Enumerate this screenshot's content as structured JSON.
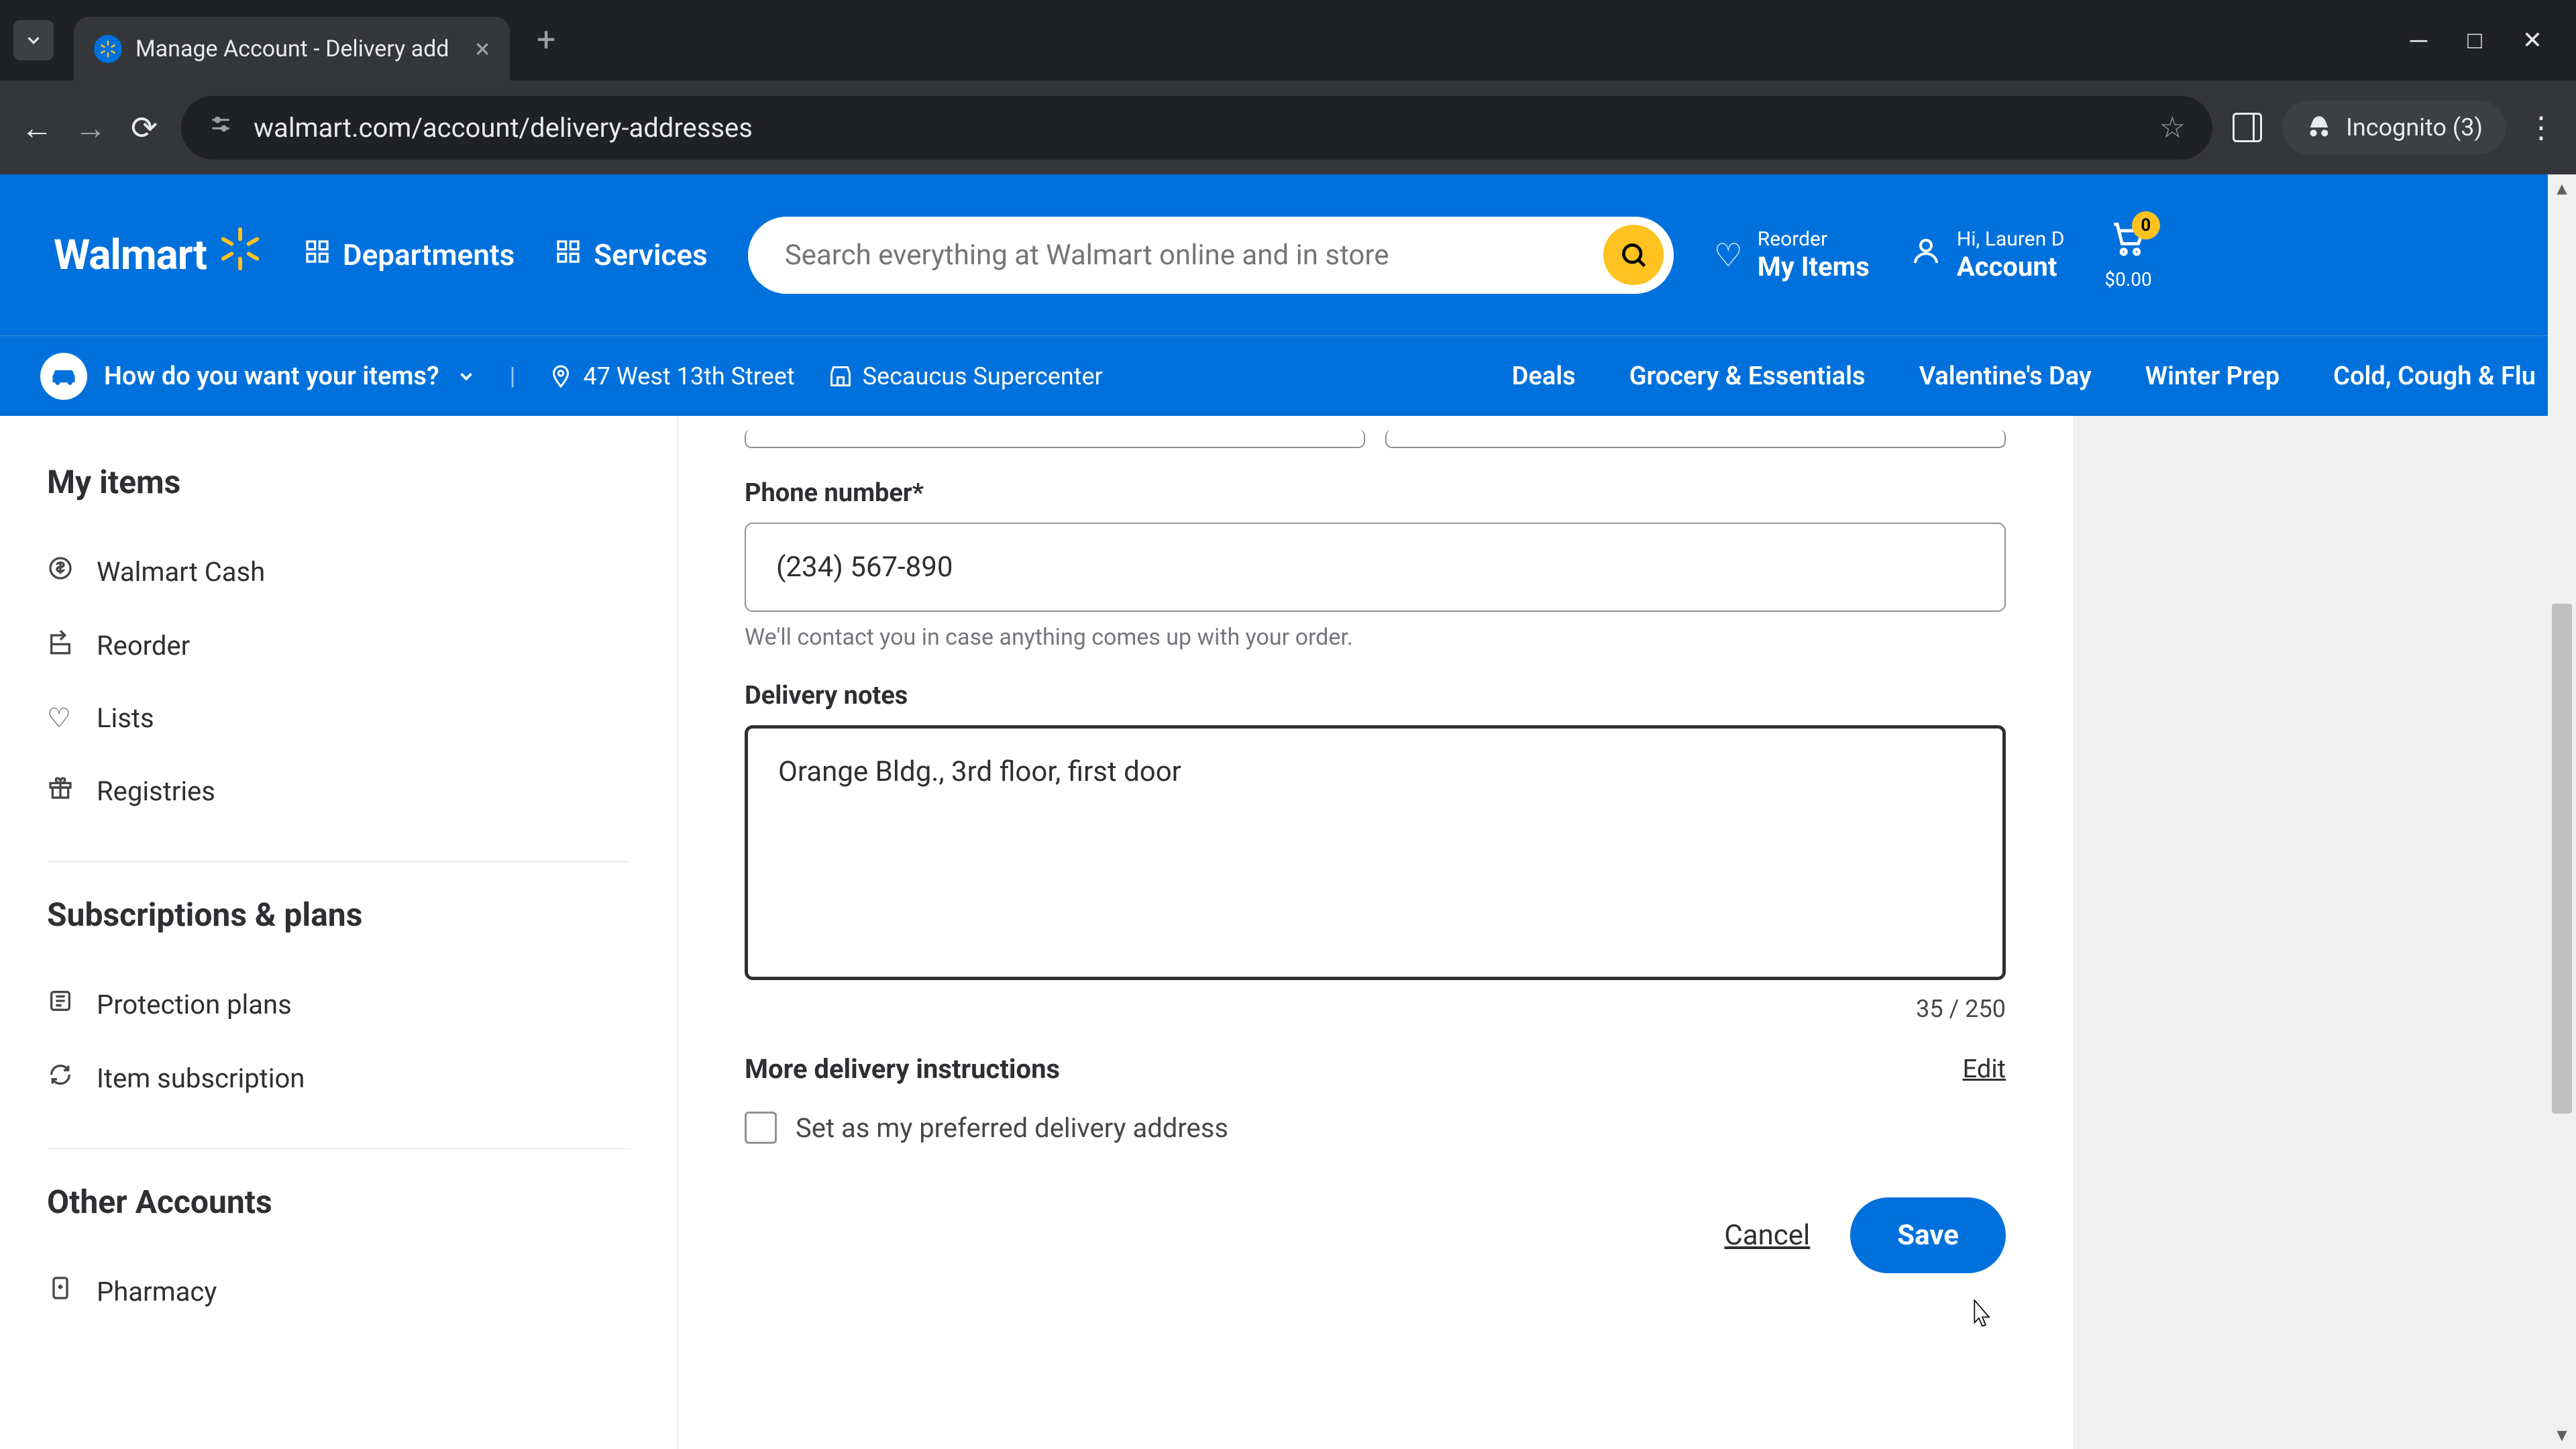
{
  "browser": {
    "tab_title": "Manage Account - Delivery add",
    "url": "walmart.com/account/delivery-addresses",
    "incognito_label": "Incognito (3)"
  },
  "header": {
    "logo_text": "Walmart",
    "departments": "Departments",
    "services": "Services",
    "search_placeholder": "Search everything at Walmart online and in store",
    "reorder_small": "Reorder",
    "reorder_large": "My Items",
    "account_small": "Hi, Lauren D",
    "account_large": "Account",
    "cart_count": "0",
    "cart_total": "$0.00"
  },
  "subnav": {
    "intent": "How do you want your items?",
    "address": "47 West 13th Street",
    "store": "Secaucus Supercenter",
    "links": [
      "Deals",
      "Grocery & Essentials",
      "Valentine's Day",
      "Winter Prep",
      "Cold, Cough & Flu"
    ]
  },
  "sidebar": {
    "heading1": "My items",
    "items1": [
      "Walmart Cash",
      "Reorder",
      "Lists",
      "Registries"
    ],
    "heading2": "Subscriptions & plans",
    "items2": [
      "Protection plans",
      "Item subscription"
    ],
    "heading3": "Other Accounts",
    "items3": [
      "Pharmacy"
    ]
  },
  "form": {
    "phone_label": "Phone number*",
    "phone_value": "(234) 567-890",
    "phone_hint": "We'll contact you in case anything comes up with your order.",
    "notes_label": "Delivery notes",
    "notes_value": "Orange Bldg., 3rd floor, first door",
    "char_count": "35 / 250",
    "more_instructions": "More delivery instructions",
    "edit": "Edit",
    "preferred_label": "Set as my preferred delivery address",
    "cancel": "Cancel",
    "save": "Save"
  }
}
